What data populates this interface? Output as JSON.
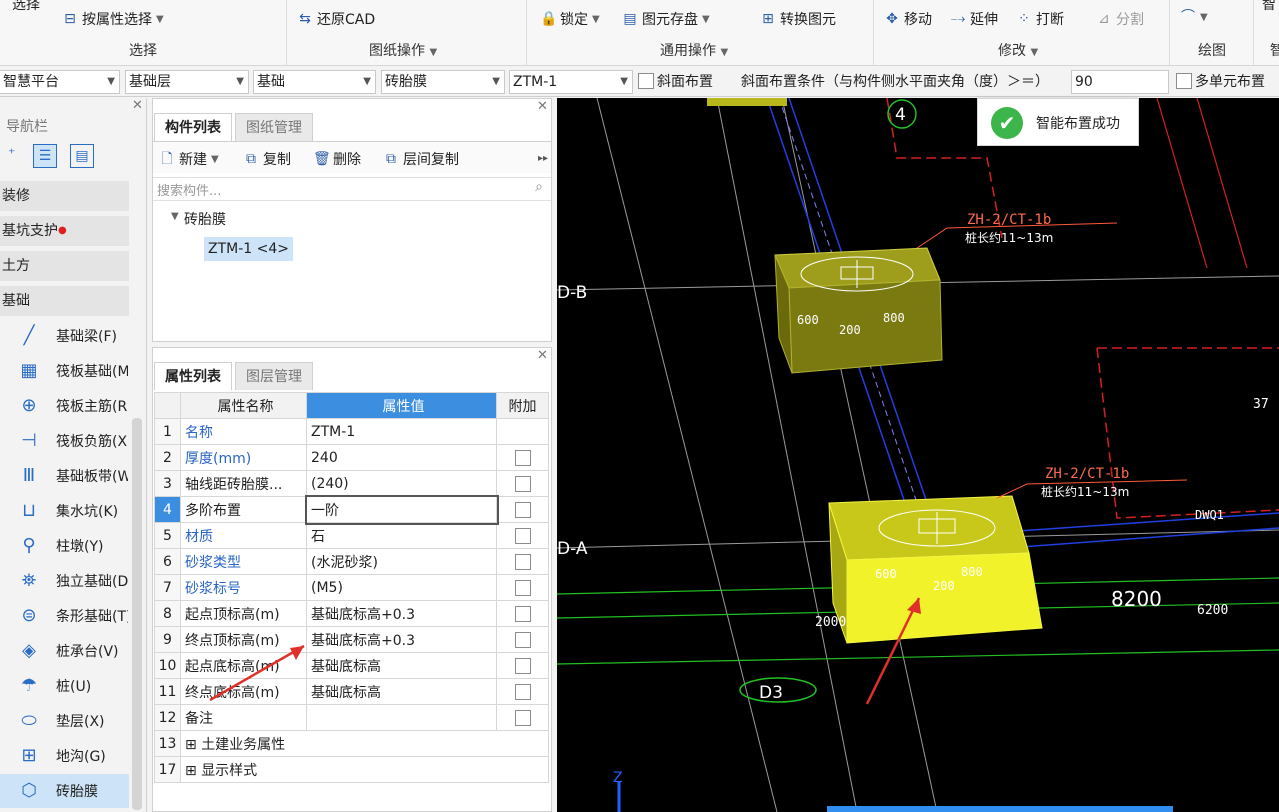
{
  "ribbon": {
    "select_top": "选择",
    "select_by_attr": "按属性选择",
    "group_select": "选择",
    "restore_cad": "还原CAD",
    "group_drawing_ops": "图纸操作",
    "lock": "锁定",
    "save_element": "图元存盘",
    "convert_element": "转换图元",
    "group_general_ops": "通用操作",
    "move": "移动",
    "extend": "延伸",
    "break": "打断",
    "split": "分割",
    "group_modify": "修改",
    "group_draw": "绘图",
    "right_cut1": "智",
    "right_cut2": "智"
  },
  "combobar": {
    "platform": "智慧平台",
    "layer": "基础层",
    "category": "基础",
    "type": "砖胎膜",
    "component": "ZTM-1",
    "slope_layout_label": "斜面布置",
    "slope_condition_label": "斜面布置条件（与构件侧水平面夹角（度）＞＝）",
    "slope_angle": "90",
    "multi_unit_label": "多单元布置"
  },
  "nav": {
    "title": "导航栏",
    "groups": [
      "装修",
      "基坑支护",
      "土方",
      "基础"
    ],
    "items": [
      {
        "label": "基础梁(F)",
        "icon": "beam-icon"
      },
      {
        "label": "筏板基础(M)",
        "icon": "raft-icon"
      },
      {
        "label": "筏板主筋(R)",
        "icon": "rebar-main-icon"
      },
      {
        "label": "筏板负筋(X)",
        "icon": "rebar-neg-icon"
      },
      {
        "label": "基础板带(W)",
        "icon": "strip-icon"
      },
      {
        "label": "集水坑(K)",
        "icon": "sump-icon"
      },
      {
        "label": "柱墩(Y)",
        "icon": "pier-icon"
      },
      {
        "label": "独立基础(D)",
        "icon": "isolated-icon"
      },
      {
        "label": "条形基础(T)",
        "icon": "strip-found-icon"
      },
      {
        "label": "桩承台(V)",
        "icon": "pilecap-icon"
      },
      {
        "label": "桩(U)",
        "icon": "pile-icon"
      },
      {
        "label": "垫层(X)",
        "icon": "cushion-icon"
      },
      {
        "label": "地沟(G)",
        "icon": "trench-icon"
      },
      {
        "label": "砖胎膜",
        "icon": "brick-mold-icon"
      }
    ]
  },
  "complist": {
    "tab_active": "构件列表",
    "tab_inactive": "图纸管理",
    "new": "新建",
    "copy": "复制",
    "delete": "删除",
    "floor_copy": "层间复制",
    "search_placeholder": "搜索构件...",
    "tree_root": "砖胎膜",
    "tree_child": "ZTM-1 <4>"
  },
  "proplist": {
    "tab_active": "属性列表",
    "tab_inactive": "图层管理",
    "col_name": "属性名称",
    "col_value": "属性值",
    "col_extra": "附加",
    "rows": [
      {
        "n": "1",
        "name": "名称",
        "value": "ZTM-1",
        "blue": true,
        "cb": false
      },
      {
        "n": "2",
        "name": "厚度(mm)",
        "value": "240",
        "blue": true,
        "cb": true
      },
      {
        "n": "3",
        "name": "轴线距砖胎膜...",
        "value": "(240)",
        "blue": false,
        "cb": true
      },
      {
        "n": "4",
        "name": "多阶布置",
        "value": "一阶",
        "blue": false,
        "cb": true
      },
      {
        "n": "5",
        "name": "材质",
        "value": "石",
        "blue": true,
        "cb": true
      },
      {
        "n": "6",
        "name": "砂浆类型",
        "value": "(水泥砂浆)",
        "blue": true,
        "cb": true
      },
      {
        "n": "7",
        "name": "砂浆标号",
        "value": "(M5)",
        "blue": true,
        "cb": true
      },
      {
        "n": "8",
        "name": "起点顶标高(m)",
        "value": "基础底标高+0.3",
        "blue": false,
        "cb": true
      },
      {
        "n": "9",
        "name": "终点顶标高(m)",
        "value": "基础底标高+0.3",
        "blue": false,
        "cb": true
      },
      {
        "n": "10",
        "name": "起点底标高(m)",
        "value": "基础底标高",
        "blue": false,
        "cb": true
      },
      {
        "n": "11",
        "name": "终点底标高(m)",
        "value": "基础底标高",
        "blue": false,
        "cb": true
      },
      {
        "n": "12",
        "name": "备注",
        "value": "",
        "blue": false,
        "cb": true
      },
      {
        "n": "13",
        "name": "土建业务属性",
        "value": "",
        "blue": false,
        "cb": false,
        "expand": true
      },
      {
        "n": "17",
        "name": "显示样式",
        "value": "",
        "blue": false,
        "cb": false,
        "expand": true
      }
    ]
  },
  "cad": {
    "axis_4": "4",
    "axis_db": "D-B",
    "axis_da": "D-A",
    "axis_d3": "D3",
    "label_zh1": "ZH-2/CT-1b",
    "label_len1": "桩长约11~13m",
    "label_zh2": "ZH-2/CT-1b",
    "label_len2": "桩长约11~13m",
    "dim_600a": "600",
    "dim_200a": "200",
    "dim_800a": "800",
    "dim_600b": "600",
    "dim_800b": "800",
    "dim_2000": "2000",
    "dim_8200": "8200",
    "dim_6200": "6200",
    "dim_37": "37",
    "dwq": "DWQ1",
    "dim_200b": "200"
  },
  "toast": {
    "message": "智能布置成功"
  },
  "colors": {
    "accent": "#3c8fe0",
    "yellow_box": "#f2f22a",
    "success": "#3cb54a",
    "arrow": "#e0302a"
  }
}
